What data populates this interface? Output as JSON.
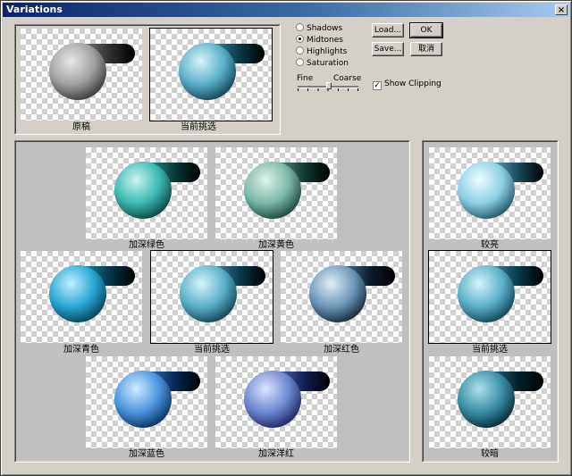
{
  "window": {
    "title": "Variations",
    "close_glyph": "×"
  },
  "options": {
    "radios": [
      {
        "label": "Shadows",
        "selected": false
      },
      {
        "label": "Midtones",
        "selected": true
      },
      {
        "label": "Highlights",
        "selected": false
      },
      {
        "label": "Saturation",
        "selected": false
      }
    ],
    "fine_label": "Fine",
    "coarse_label": "Coarse",
    "show_clipping_label": "Show Clipping",
    "show_clipping_checked": true,
    "check_glyph": "✓"
  },
  "buttons": {
    "load": "Load...",
    "save": "Save...",
    "ok": "OK",
    "cancel": "取消"
  },
  "thumbs": {
    "original": "原稿",
    "current_top": "当前挑选",
    "more_green": "加深绿色",
    "more_yellow": "加深黄色",
    "more_cyan": "加深青色",
    "current_center": "当前挑选",
    "more_red": "加深红色",
    "more_blue": "加深蓝色",
    "more_magenta": "加深洋红",
    "lighter": "较亮",
    "current_right": "当前挑选",
    "darker": "较暗"
  },
  "colors": {
    "title_bar": "#0a246a",
    "dialog_bg": "#d4d0c8",
    "panel_bg": "#c0c0c0"
  }
}
